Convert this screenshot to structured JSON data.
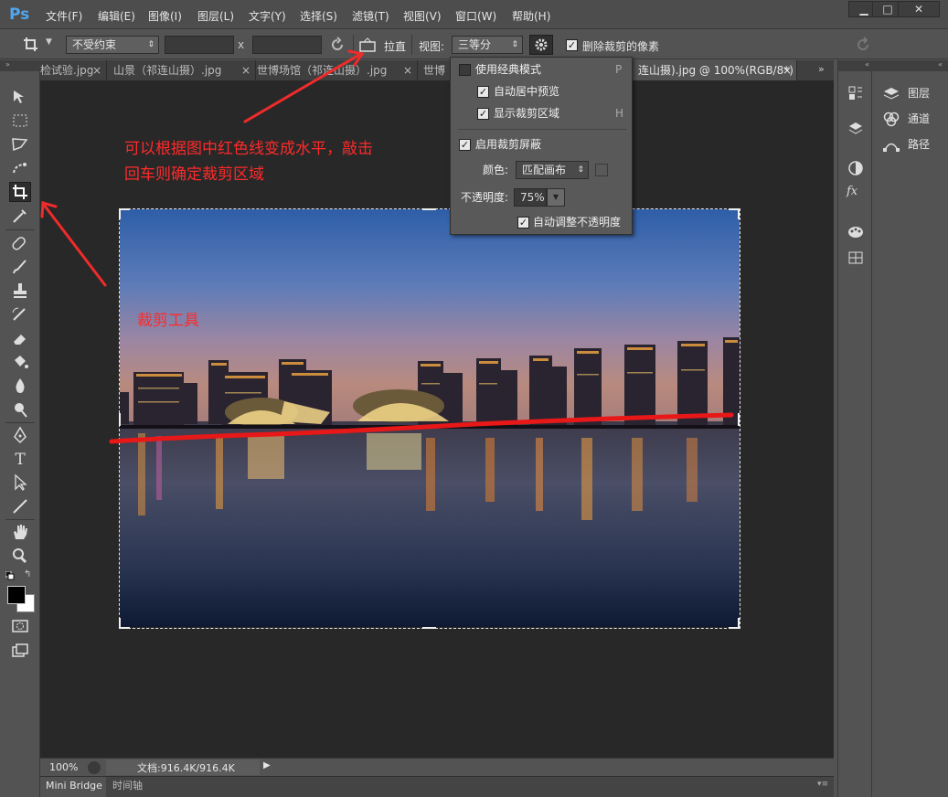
{
  "app": {
    "logo": "Ps"
  },
  "menu": [
    "文件(F)",
    "编辑(E)",
    "图像(I)",
    "图层(L)",
    "文字(Y)",
    "选择(S)",
    "滤镜(T)",
    "视图(V)",
    "窗口(W)",
    "帮助(H)"
  ],
  "window_controls": {
    "minimize": "▁",
    "maximize": "□",
    "close": "✕"
  },
  "options": {
    "ratio_select": "不受约束",
    "width_value": "",
    "height_value": "",
    "swap_symbol": "x",
    "straighten_label": "拉直",
    "view_label": "视图:",
    "view_select": "三等分",
    "delete_cropped_label": "删除裁剪的像素"
  },
  "tabs": [
    {
      "label": "检试验.jpg",
      "close": "×"
    },
    {
      "label": "山景（祁连山摄）.jpg",
      "close": "×"
    },
    {
      "label": "世博场馆（祁连山摄）.jpg",
      "close": "×"
    },
    {
      "label": "世博",
      "close": "×"
    },
    {
      "label": "连山摄).jpg @ 100%(RGB/8*) *",
      "close": "×"
    }
  ],
  "popup": {
    "classic_mode": "使用经典模式",
    "classic_shortcut": "P",
    "auto_center": "自动居中预览",
    "show_crop_area": "显示裁剪区域",
    "show_crop_shortcut": "H",
    "enable_shield": "启用裁剪屏蔽",
    "color_label": "颜色:",
    "color_select": "匹配画布",
    "opacity_label": "不透明度:",
    "opacity_value": "75%",
    "auto_adjust_opacity": "自动调整不透明度"
  },
  "annotations": {
    "instruction_line1": "可以根据图中红色线变成水平，敲击",
    "instruction_line2": "回车则确定裁剪区域",
    "crop_tool_label": "裁剪工具"
  },
  "panels": {
    "layers": "图层",
    "channels": "通道",
    "paths": "路径"
  },
  "status": {
    "zoom": "100%",
    "doc_info": "文档:916.4K/916.4K"
  },
  "bottom_tabs": [
    "Mini Bridge",
    "时间轴"
  ],
  "colors": {
    "annotation_red": "#ff2a2a",
    "ps_blue": "#4fa6ee",
    "canvas_bg": "#282828"
  }
}
